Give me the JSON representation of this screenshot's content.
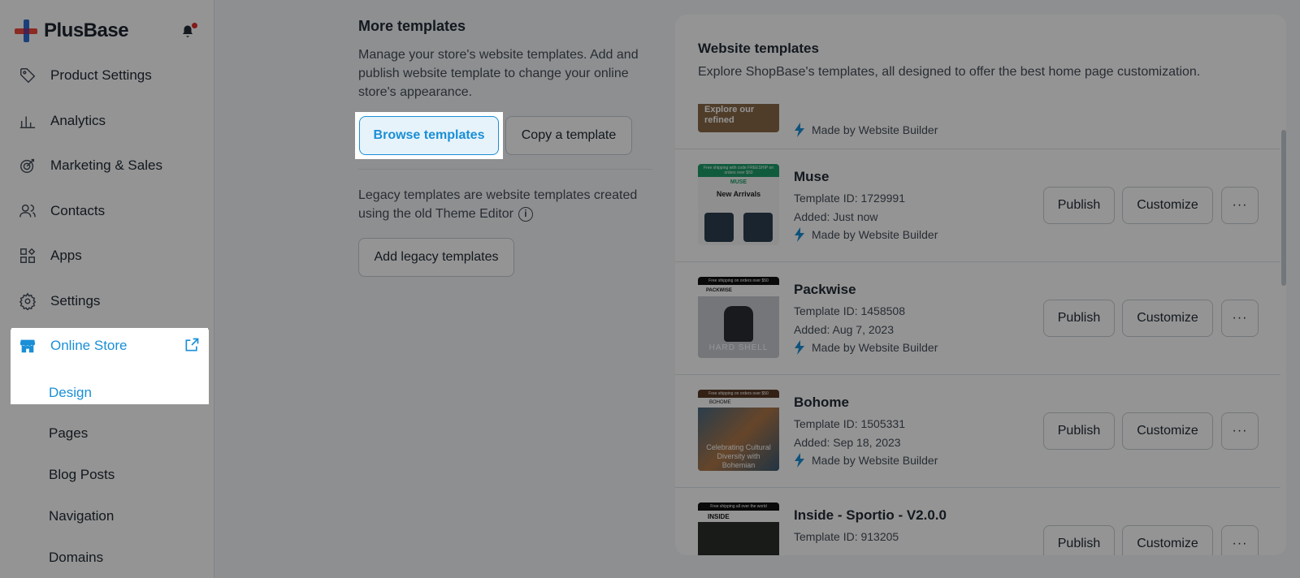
{
  "app": {
    "name": "PlusBase"
  },
  "sidebar": {
    "items": [
      {
        "label": "Product Settings",
        "icon": "tag-icon"
      },
      {
        "label": "Analytics",
        "icon": "bar-chart-icon"
      },
      {
        "label": "Marketing & Sales",
        "icon": "target-icon"
      },
      {
        "label": "Contacts",
        "icon": "contacts-icon"
      },
      {
        "label": "Apps",
        "icon": "apps-icon"
      },
      {
        "label": "Settings",
        "icon": "gear-icon"
      },
      {
        "label": "Online Store",
        "icon": "store-icon"
      }
    ],
    "sub_items": [
      "Design",
      "Pages",
      "Blog Posts",
      "Navigation",
      "Domains"
    ]
  },
  "more_templates": {
    "title": "More templates",
    "description": "Manage your store's website templates. Add and publish website template to change your online store's appearance.",
    "browse_label": "Browse templates",
    "copy_label": "Copy a template",
    "legacy_description": "Legacy templates are website templates created using the old Theme Editor",
    "legacy_button": "Add legacy templates"
  },
  "website_templates": {
    "title": "Website templates",
    "description": "Explore ShopBase's templates, all designed to offer the best home page customization.",
    "partial_row": {
      "thumb_text": "Explore our refined",
      "made_by": "Made by Website Builder"
    },
    "rows": [
      {
        "name": "Muse",
        "template_id": "Template ID: 1729991",
        "added": "Added: Just now",
        "made_by": "Made by Website Builder",
        "thumb_header": "MUSE",
        "thumb_title": "New Arrivals",
        "thumb_banner": "Free shipping with code FREESHIP on orders over $50"
      },
      {
        "name": "Packwise",
        "template_id": "Template ID: 1458508",
        "added": "Added: Aug 7, 2023",
        "made_by": "Made by Website Builder",
        "thumb_header": "PACKWISE",
        "thumb_title": "HARD SHELL",
        "thumb_banner": "Free shipping on orders over $50"
      },
      {
        "name": "Bohome",
        "template_id": "Template ID: 1505331",
        "added": "Added: Sep 18, 2023",
        "made_by": "Made by Website Builder",
        "thumb_header": "BOHOME",
        "thumb_title": "Celebrating Cultural Diversity with Bohemian",
        "thumb_banner": "Free shipping on orders over $50"
      },
      {
        "name": "Inside - Sportio - V2.0.0",
        "template_id": "Template ID: 913205",
        "added": "",
        "made_by": "",
        "thumb_header": "INSIDE",
        "thumb_title": "",
        "thumb_banner": "Free shipping all over the world"
      }
    ],
    "publish_label": "Publish",
    "customize_label": "Customize",
    "more_label": "···"
  }
}
